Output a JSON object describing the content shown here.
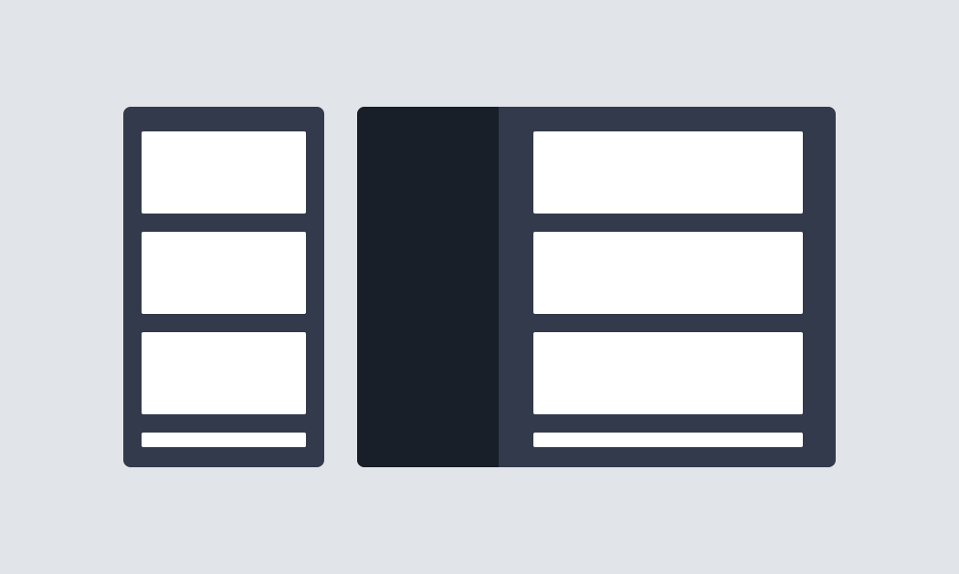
{
  "colors": {
    "background": "#e1e5e9",
    "panel": "#323a4c",
    "sidebar": "#181f28",
    "card": "#ffffff"
  },
  "layouts": [
    {
      "name": "mobile-layout",
      "has_sidebar": false,
      "visible_cards": 4
    },
    {
      "name": "desktop-layout",
      "has_sidebar": true,
      "visible_cards": 4
    }
  ]
}
